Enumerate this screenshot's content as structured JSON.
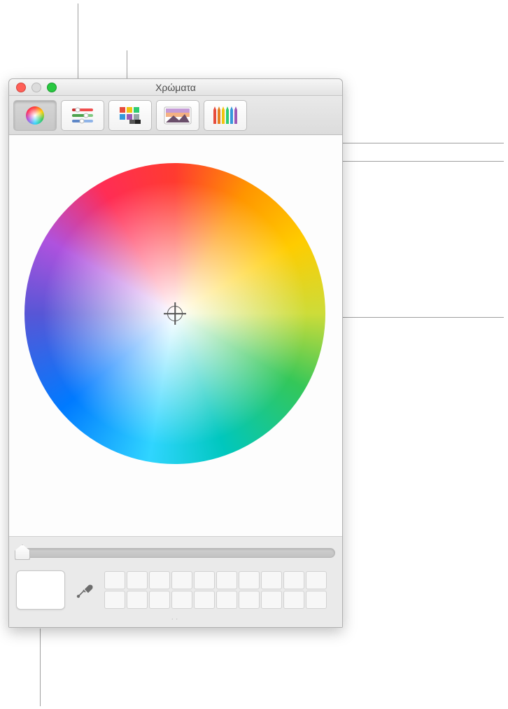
{
  "window": {
    "title": "Χρώματα"
  },
  "toolbar": {
    "tabs": [
      {
        "id": "wheel",
        "name": "color-wheel-tab",
        "selected": true
      },
      {
        "id": "sliders",
        "name": "color-sliders-tab",
        "selected": false
      },
      {
        "id": "palettes",
        "name": "color-palettes-tab",
        "selected": false
      },
      {
        "id": "image",
        "name": "image-palettes-tab",
        "selected": false
      },
      {
        "id": "pencils",
        "name": "pencils-tab",
        "selected": false
      }
    ]
  },
  "wheel": {
    "brightness_percent": 0
  },
  "swatches": {
    "count": 20
  }
}
